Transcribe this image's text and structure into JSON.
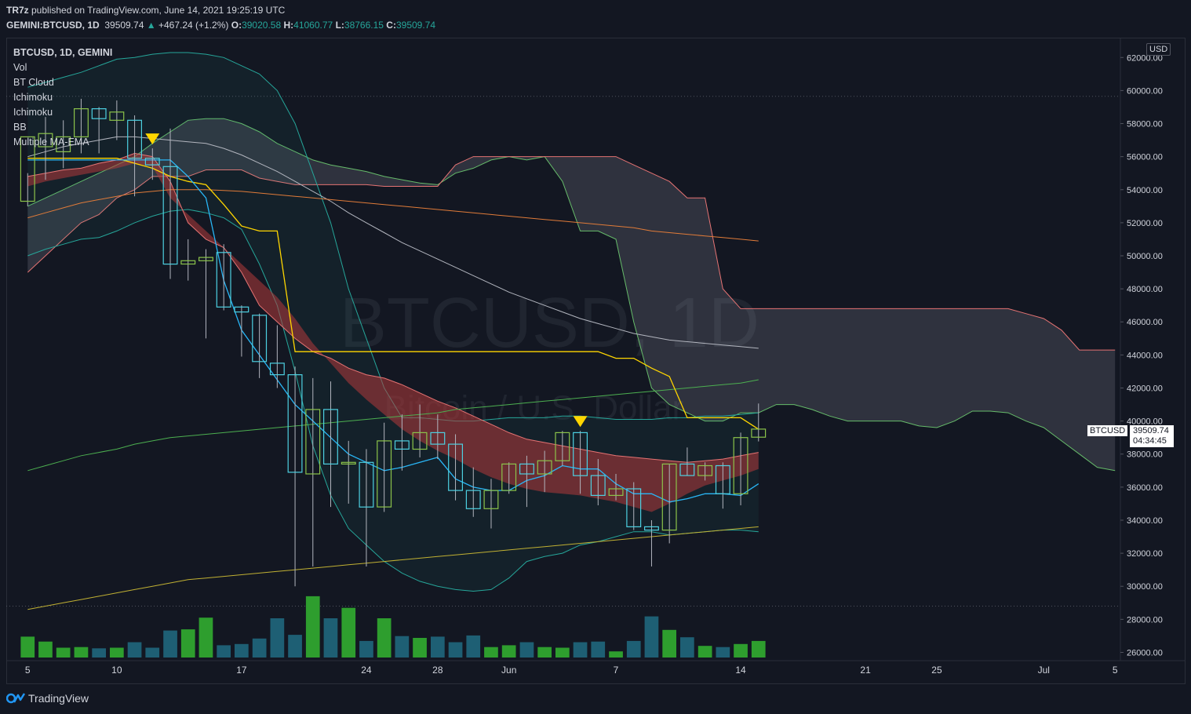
{
  "header": {
    "author": "TR7z",
    "published": " published on TradingView.com, June 14, 2021 19:25:19 UTC",
    "symbol": "GEMINI:BTCUSD, 1D",
    "last": "39509.74",
    "change": "+467.24 (+1.2%)",
    "o_label": "O:",
    "o": "39020.58",
    "h_label": "H:",
    "h": "41060.77",
    "l_label": "L:",
    "l": "38766.15",
    "c_label": "C:",
    "c": "39509.74"
  },
  "legend": [
    "BTCUSD, 1D, GEMINI",
    "Vol",
    "BT Cloud",
    "Ichimoku",
    "Ichimoku",
    "BB",
    "Multiple MA-EMA"
  ],
  "watermark": {
    "symbol": "BTCUSD, 1D",
    "description": "Bitcoin / U.S. Dollar"
  },
  "price_axis": {
    "currency": "USD",
    "symbol_tag": "BTCUSD",
    "current_price": "39509.74",
    "countdown": "04:34:45"
  },
  "footer": {
    "brand": "TradingView"
  },
  "colors": {
    "background": "#131722",
    "up": "#26a69a",
    "bull_candle": "#8bc34a",
    "bear_candle": "#4dd0e1",
    "signal": "#ffd600",
    "cloud_red": "#e57373",
    "cloud_green": "#66bb6a"
  },
  "chart_data": {
    "type": "candlestick",
    "y_ticks": [
      26000,
      28000,
      30000,
      32000,
      34000,
      36000,
      38000,
      40000,
      42000,
      44000,
      46000,
      48000,
      50000,
      52000,
      54000,
      56000,
      58000,
      60000,
      62000
    ],
    "y_range": [
      25500,
      63200
    ],
    "x_ticks": [
      {
        "label": "5",
        "day": 0
      },
      {
        "label": "10",
        "day": 5
      },
      {
        "label": "17",
        "day": 12
      },
      {
        "label": "24",
        "day": 19
      },
      {
        "label": "28",
        "day": 23
      },
      {
        "label": "Jun",
        "day": 27
      },
      {
        "label": "7",
        "day": 33
      },
      {
        "label": "14",
        "day": 40
      },
      {
        "label": "21",
        "day": 47
      },
      {
        "label": "25",
        "day": 51
      },
      {
        "label": "Jul",
        "day": 57
      },
      {
        "label": "5",
        "day": 61
      }
    ],
    "x_range_days": [
      -1.2,
      61.3
    ],
    "candles": [
      {
        "o": 53300,
        "h": 55000,
        "l": 53000,
        "c": 57200
      },
      {
        "o": 56600,
        "h": 58400,
        "l": 54600,
        "c": 57400
      },
      {
        "o": 56300,
        "h": 58200,
        "l": 55300,
        "c": 57200
      },
      {
        "o": 57200,
        "h": 59500,
        "l": 56200,
        "c": 58900
      },
      {
        "o": 58900,
        "h": 59000,
        "l": 56200,
        "c": 58300
      },
      {
        "o": 58200,
        "h": 59400,
        "l": 57000,
        "c": 58700
      },
      {
        "o": 58200,
        "h": 58500,
        "l": 53600,
        "c": 55900
      },
      {
        "o": 55900,
        "h": 56500,
        "l": 54600,
        "c": 55500
      },
      {
        "o": 55400,
        "h": 57700,
        "l": 48600,
        "c": 49500
      },
      {
        "o": 49500,
        "h": 51000,
        "l": 48500,
        "c": 49700
      },
      {
        "o": 49700,
        "h": 50400,
        "l": 45000,
        "c": 49900
      },
      {
        "o": 50200,
        "h": 50700,
        "l": 46700,
        "c": 46900
      },
      {
        "o": 46900,
        "h": 47000,
        "l": 43900,
        "c": 46600
      },
      {
        "o": 46400,
        "h": 46500,
        "l": 42600,
        "c": 43600
      },
      {
        "o": 43500,
        "h": 45800,
        "l": 42000,
        "c": 42800
      },
      {
        "o": 42800,
        "h": 43300,
        "l": 30000,
        "c": 36900
      },
      {
        "o": 36800,
        "h": 42600,
        "l": 31200,
        "c": 40700
      },
      {
        "o": 40700,
        "h": 42400,
        "l": 34800,
        "c": 37400
      },
      {
        "o": 37400,
        "h": 38800,
        "l": 35000,
        "c": 37500
      },
      {
        "o": 37500,
        "h": 38300,
        "l": 31200,
        "c": 34800
      },
      {
        "o": 34800,
        "h": 39900,
        "l": 34500,
        "c": 38800
      },
      {
        "o": 38800,
        "h": 40400,
        "l": 37000,
        "c": 38300
      },
      {
        "o": 38300,
        "h": 41000,
        "l": 37800,
        "c": 39300
      },
      {
        "o": 39300,
        "h": 40400,
        "l": 37700,
        "c": 38600
      },
      {
        "o": 38600,
        "h": 39200,
        "l": 35200,
        "c": 35800
      },
      {
        "o": 35800,
        "h": 37200,
        "l": 34200,
        "c": 34700
      },
      {
        "o": 34700,
        "h": 36500,
        "l": 33500,
        "c": 35800
      },
      {
        "o": 35800,
        "h": 37500,
        "l": 35600,
        "c": 37400
      },
      {
        "o": 37400,
        "h": 37900,
        "l": 34800,
        "c": 36800
      },
      {
        "o": 36800,
        "h": 38200,
        "l": 35700,
        "c": 37600
      },
      {
        "o": 37600,
        "h": 39400,
        "l": 37300,
        "c": 39300
      },
      {
        "o": 39300,
        "h": 39400,
        "l": 35600,
        "c": 36700
      },
      {
        "o": 36700,
        "h": 37700,
        "l": 34900,
        "c": 35500
      },
      {
        "o": 35500,
        "h": 36800,
        "l": 35200,
        "c": 35900
      },
      {
        "o": 35900,
        "h": 36300,
        "l": 33400,
        "c": 33600
      },
      {
        "o": 33600,
        "h": 34000,
        "l": 31200,
        "c": 33400
      },
      {
        "o": 33400,
        "h": 37400,
        "l": 32600,
        "c": 37400
      },
      {
        "o": 37400,
        "h": 38400,
        "l": 36700,
        "c": 36700
      },
      {
        "o": 36700,
        "h": 37500,
        "l": 36400,
        "c": 37300
      },
      {
        "o": 37300,
        "h": 37500,
        "l": 34700,
        "c": 35600
      },
      {
        "o": 35600,
        "h": 39300,
        "l": 34900,
        "c": 39000
      },
      {
        "o": 39020.58,
        "h": 41060.77,
        "l": 38766.15,
        "c": 39509.74
      }
    ],
    "volume_relative": [
      0.34,
      0.26,
      0.16,
      0.17,
      0.15,
      0.16,
      0.25,
      0.16,
      0.44,
      0.46,
      0.65,
      0.2,
      0.22,
      0.31,
      0.64,
      0.37,
      1.0,
      0.64,
      0.81,
      0.27,
      0.64,
      0.35,
      0.32,
      0.34,
      0.25,
      0.36,
      0.17,
      0.2,
      0.25,
      0.17,
      0.16,
      0.25,
      0.26,
      0.1,
      0.27,
      0.67,
      0.45,
      0.33,
      0.19,
      0.17,
      0.22,
      0.27
    ],
    "bt_cloud_upper": [
      54800,
      55000,
      55200,
      55300,
      55600,
      55800,
      56200,
      56000,
      54500,
      52000,
      51000,
      50500,
      49000,
      47000,
      46000,
      45000,
      44200,
      43800,
      43200,
      42800,
      42600,
      42200,
      41700,
      41200,
      40800,
      40300,
      39800,
      39300,
      38900,
      38700,
      38500,
      38300,
      38100,
      37900,
      37800,
      37700,
      37600,
      37500,
      37600,
      37700,
      37900,
      38100
    ],
    "bt_cloud_lower": [
      54200,
      54500,
      54700,
      54900,
      55100,
      55300,
      55600,
      55400,
      53500,
      52500,
      51500,
      50500,
      49500,
      48500,
      47500,
      46200,
      44700,
      43500,
      42300,
      41300,
      40400,
      39500,
      38800,
      38200,
      37700,
      37100,
      36600,
      36200,
      35900,
      35700,
      35600,
      35500,
      35300,
      35100,
      34800,
      34500,
      35000,
      35600,
      36100,
      36400,
      36700,
      37100
    ],
    "bb_upper": [
      60200,
      60500,
      60800,
      61100,
      61500,
      61900,
      62000,
      62200,
      62300,
      62300,
      62200,
      62000,
      61500,
      61000,
      60000,
      58000,
      55000,
      52000,
      48000,
      45000,
      42000,
      40200,
      40200,
      40100,
      40000,
      40000,
      40100,
      40200,
      40200,
      40200,
      40300,
      40300,
      40200,
      40100,
      40100,
      40100,
      40200,
      40200,
      40300,
      40300,
      40400,
      40500
    ],
    "bb_lower": [
      50000,
      50400,
      50700,
      51000,
      51100,
      51500,
      52000,
      52400,
      52700,
      52800,
      52600,
      52300,
      51600,
      49500,
      47000,
      43000,
      38500,
      35500,
      33500,
      32500,
      31500,
      30800,
      30300,
      30000,
      29800,
      29700,
      29800,
      30500,
      31500,
      31800,
      32000,
      32500,
      32700,
      33000,
      33300,
      33300,
      33100,
      33200,
      33300,
      33400,
      33400,
      33300
    ],
    "bb_basis": [
      56000,
      56300,
      56600,
      56800,
      57000,
      57200,
      57200,
      57100,
      57000,
      56900,
      56800,
      56500,
      56100,
      55600,
      55100,
      54500,
      53900,
      53300,
      52600,
      52000,
      51400,
      50800,
      50300,
      49800,
      49300,
      48800,
      48300,
      47800,
      47400,
      47000,
      46600,
      46200,
      45900,
      45600,
      45300,
      45100,
      44900,
      44800,
      44700,
      44600,
      44500,
      44400
    ],
    "conversion_line": [
      55900,
      55900,
      55900,
      55900,
      55900,
      55900,
      55600,
      55300,
      54800,
      54500,
      54300,
      53100,
      51800,
      51500,
      51500,
      44200,
      44200,
      44200,
      44200,
      44200,
      44200,
      44200,
      44200,
      44200,
      44200,
      44200,
      44200,
      44200,
      44200,
      44200,
      44200,
      44200,
      44200,
      43800,
      43800,
      43200,
      42700,
      40200,
      40200,
      40200,
      40200,
      39500
    ],
    "base_line": [
      55800,
      55800,
      55800,
      55800,
      55800,
      55800,
      55800,
      55800,
      55800,
      54800,
      53500,
      48500,
      45500,
      44000,
      42500,
      41000,
      40000,
      39000,
      38000,
      37500,
      37000,
      37200,
      37500,
      37800,
      36500,
      36000,
      35800,
      35800,
      36400,
      36700,
      37300,
      37100,
      37100,
      36200,
      35600,
      35600,
      35100,
      35300,
      35600,
      35600,
      35500,
      36200
    ],
    "ichimoku_span_a": [
      53000,
      53500,
      54000,
      54500,
      55000,
      55500,
      56000,
      56800,
      57500,
      58200,
      58300,
      58300,
      58000,
      57500,
      56800,
      56300,
      55800,
      55500,
      55300,
      55100,
      54800,
      54600,
      54400,
      54300,
      55000,
      55300,
      55800,
      56000,
      55800,
      56000,
      54500,
      51500,
      51500,
      51000,
      46000,
      42000,
      41000,
      40500,
      40000,
      40000,
      40500,
      40500,
      41000,
      41000,
      40700,
      40300,
      40000,
      40000,
      40000,
      40000,
      39700,
      39600,
      40000,
      40600,
      40600,
      40500,
      40000,
      39600,
      38800,
      38000,
      37200,
      37000
    ],
    "ichimoku_span_b": [
      49000,
      50000,
      51000,
      52000,
      52500,
      53500,
      54000,
      54800,
      54800,
      54800,
      55200,
      55200,
      55200,
      54700,
      54500,
      54300,
      54300,
      54300,
      54300,
      54300,
      54200,
      54200,
      54200,
      54200,
      55500,
      56000,
      56000,
      56000,
      56000,
      56000,
      56000,
      56000,
      56000,
      56000,
      55500,
      55000,
      54500,
      53500,
      53500,
      48000,
      46800,
      46800,
      46800,
      46800,
      46800,
      46800,
      46800,
      46800,
      46800,
      46800,
      46800,
      46800,
      46800,
      46800,
      46800,
      46800,
      46500,
      46200,
      45500,
      44300,
      44300,
      44300
    ],
    "ma_long": [
      52300,
      52600,
      52900,
      53200,
      53400,
      53600,
      53800,
      53900,
      54000,
      54000,
      54000,
      53950,
      53900,
      53800,
      53700,
      53600,
      53500,
      53400,
      53300,
      53200,
      53100,
      53000,
      52900,
      52800,
      52700,
      52600,
      52500,
      52400,
      52300,
      52200,
      52100,
      52000,
      51900,
      51800,
      51700,
      51500,
      51400,
      51300,
      51200,
      51100,
      51000,
      50900
    ],
    "trend_upper": [
      37000,
      37300,
      37600,
      37900,
      38100,
      38300,
      38600,
      38800,
      39000,
      39100,
      39200,
      39300,
      39400,
      39500,
      39600,
      39700,
      39800,
      39900,
      40000,
      40100,
      40200,
      40300,
      40400,
      40500,
      40700,
      40800,
      40900,
      41000,
      41100,
      41200,
      41300,
      41400,
      41500,
      41600,
      41700,
      41800,
      41900,
      42000,
      42100,
      42200,
      42300,
      42500
    ],
    "trend_lower": [
      28600,
      28800,
      29000,
      29200,
      29400,
      29600,
      29800,
      30000,
      30200,
      30400,
      30500,
      30600,
      30700,
      30800,
      30900,
      31000,
      31100,
      31200,
      31300,
      31400,
      31500,
      31600,
      31700,
      31800,
      31900,
      32000,
      32100,
      32200,
      32300,
      32400,
      32500,
      32600,
      32700,
      32800,
      32900,
      33000,
      33100,
      33200,
      33300,
      33400,
      33500,
      33600
    ],
    "sell_signals_day": [
      7,
      31
    ]
  }
}
